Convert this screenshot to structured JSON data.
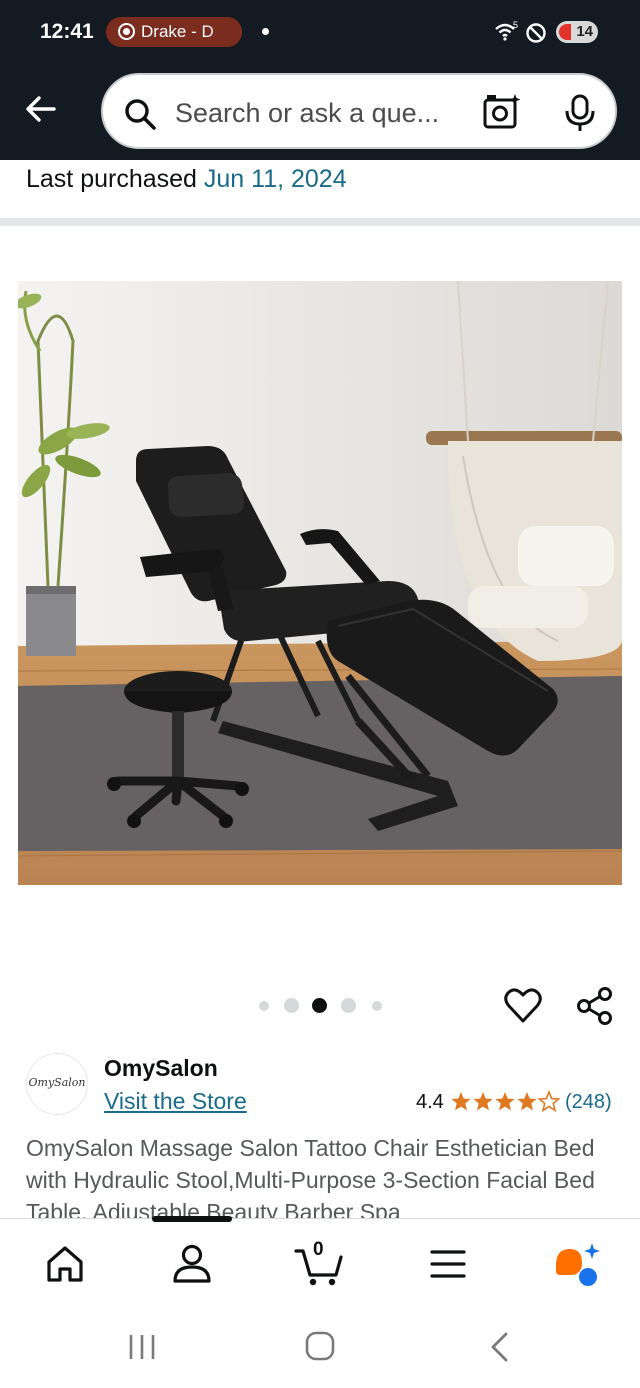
{
  "status_bar": {
    "time": "12:41",
    "notification_pill": "Drake - D",
    "wifi_label": "5",
    "battery": "14"
  },
  "header": {
    "search_placeholder": "Search or ask a que...",
    "icons": [
      "back-arrow-icon",
      "search-icon",
      "camera-search-icon",
      "microphone-icon"
    ]
  },
  "purchase": {
    "label": "Last purchased",
    "date": "Jun 11, 2024"
  },
  "product": {
    "image_alt": "Black salon chair with stool",
    "carousel_dots": 5,
    "active_dot": 3,
    "store": {
      "logo_text": "OmySalon",
      "name": "OmySalon",
      "visit_label": "Visit the Store"
    },
    "rating": "4.4",
    "rating_value": 4.4,
    "review_count": "(248)",
    "title": "OmySalon Massage Salon Tattoo Chair Esthetician Bed with Hydraulic Stool,Multi-Purpose 3-Section Facial Bed Table, Adjustable Beauty Barber Spa"
  },
  "bottom_nav": {
    "items": [
      "home-icon",
      "account-icon",
      "cart-icon",
      "menu-icon",
      "rufus-icon"
    ],
    "cart_count": "0"
  },
  "colors": {
    "header_bg": "#131a22",
    "link": "#1a6a8a",
    "star": "#de7921",
    "accent": "#ff6f00"
  }
}
